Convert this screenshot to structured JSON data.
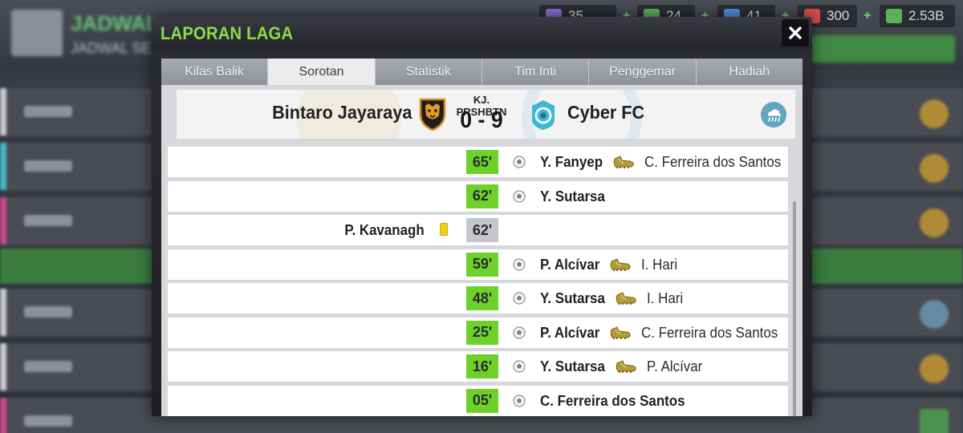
{
  "background": {
    "title": "JADWAL",
    "subtitle": "JADWAL SE",
    "currencies": [
      {
        "icon": "token-icon",
        "value": "35",
        "color": "#8a6bd0"
      },
      {
        "icon": "cash-icon",
        "value": "24",
        "color": "#5fae59"
      },
      {
        "icon": "boost-icon",
        "value": "41",
        "color": "#4f8fd6"
      },
      {
        "icon": "medical-icon",
        "value": "300",
        "color": "#d84b4b"
      },
      {
        "icon": "money-icon",
        "value": "2.53B",
        "color": "#5fae59"
      }
    ],
    "plus_label": "+"
  },
  "modal": {
    "title": "LAPORAN LAGA",
    "close_label": "✕",
    "tabs": [
      {
        "label": "Kilas Balik",
        "active": false
      },
      {
        "label": "Sorotan",
        "active": true
      },
      {
        "label": "Statistik",
        "active": false
      },
      {
        "label": "Tim Inti",
        "active": false
      },
      {
        "label": "Penggemar",
        "active": false
      },
      {
        "label": "Hadiah",
        "active": false
      }
    ]
  },
  "match": {
    "home_team": "Bintaro Jayaraya",
    "away_team": "Cyber FC",
    "competition": "KJ. PRSHBTN",
    "score": "0 - 9",
    "home_crest": "tiger-crest-icon",
    "away_crest": "cyber-crest-icon",
    "weather": "rain-cloud-icon"
  },
  "events": [
    {
      "minute": "65'",
      "type": "goal",
      "scorer": "Y. Fanyep",
      "assist": "C. Ferreira dos Santos"
    },
    {
      "minute": "62'",
      "type": "goal",
      "scorer": "Y. Sutarsa",
      "assist": ""
    },
    {
      "minute": "62'",
      "type": "yellow_card",
      "player": "P. Kavanagh"
    },
    {
      "minute": "59'",
      "type": "goal",
      "scorer": "P. Alcívar",
      "assist": "I. Hari"
    },
    {
      "minute": "48'",
      "type": "goal",
      "scorer": "Y. Sutarsa",
      "assist": "I. Hari"
    },
    {
      "minute": "25'",
      "type": "goal",
      "scorer": "P. Alcívar",
      "assist": "C. Ferreira dos Santos"
    },
    {
      "minute": "16'",
      "type": "goal",
      "scorer": "Y. Sutarsa",
      "assist": "P. Alcívar"
    },
    {
      "minute": "05'",
      "type": "goal",
      "scorer": "C. Ferreira dos Santos",
      "assist": ""
    }
  ],
  "colors": {
    "title_green": "#8bdc4c",
    "goal_badge": "#6cd22a",
    "card_badge": "#c5c6c9",
    "yellow_card": "#f1cf14"
  }
}
